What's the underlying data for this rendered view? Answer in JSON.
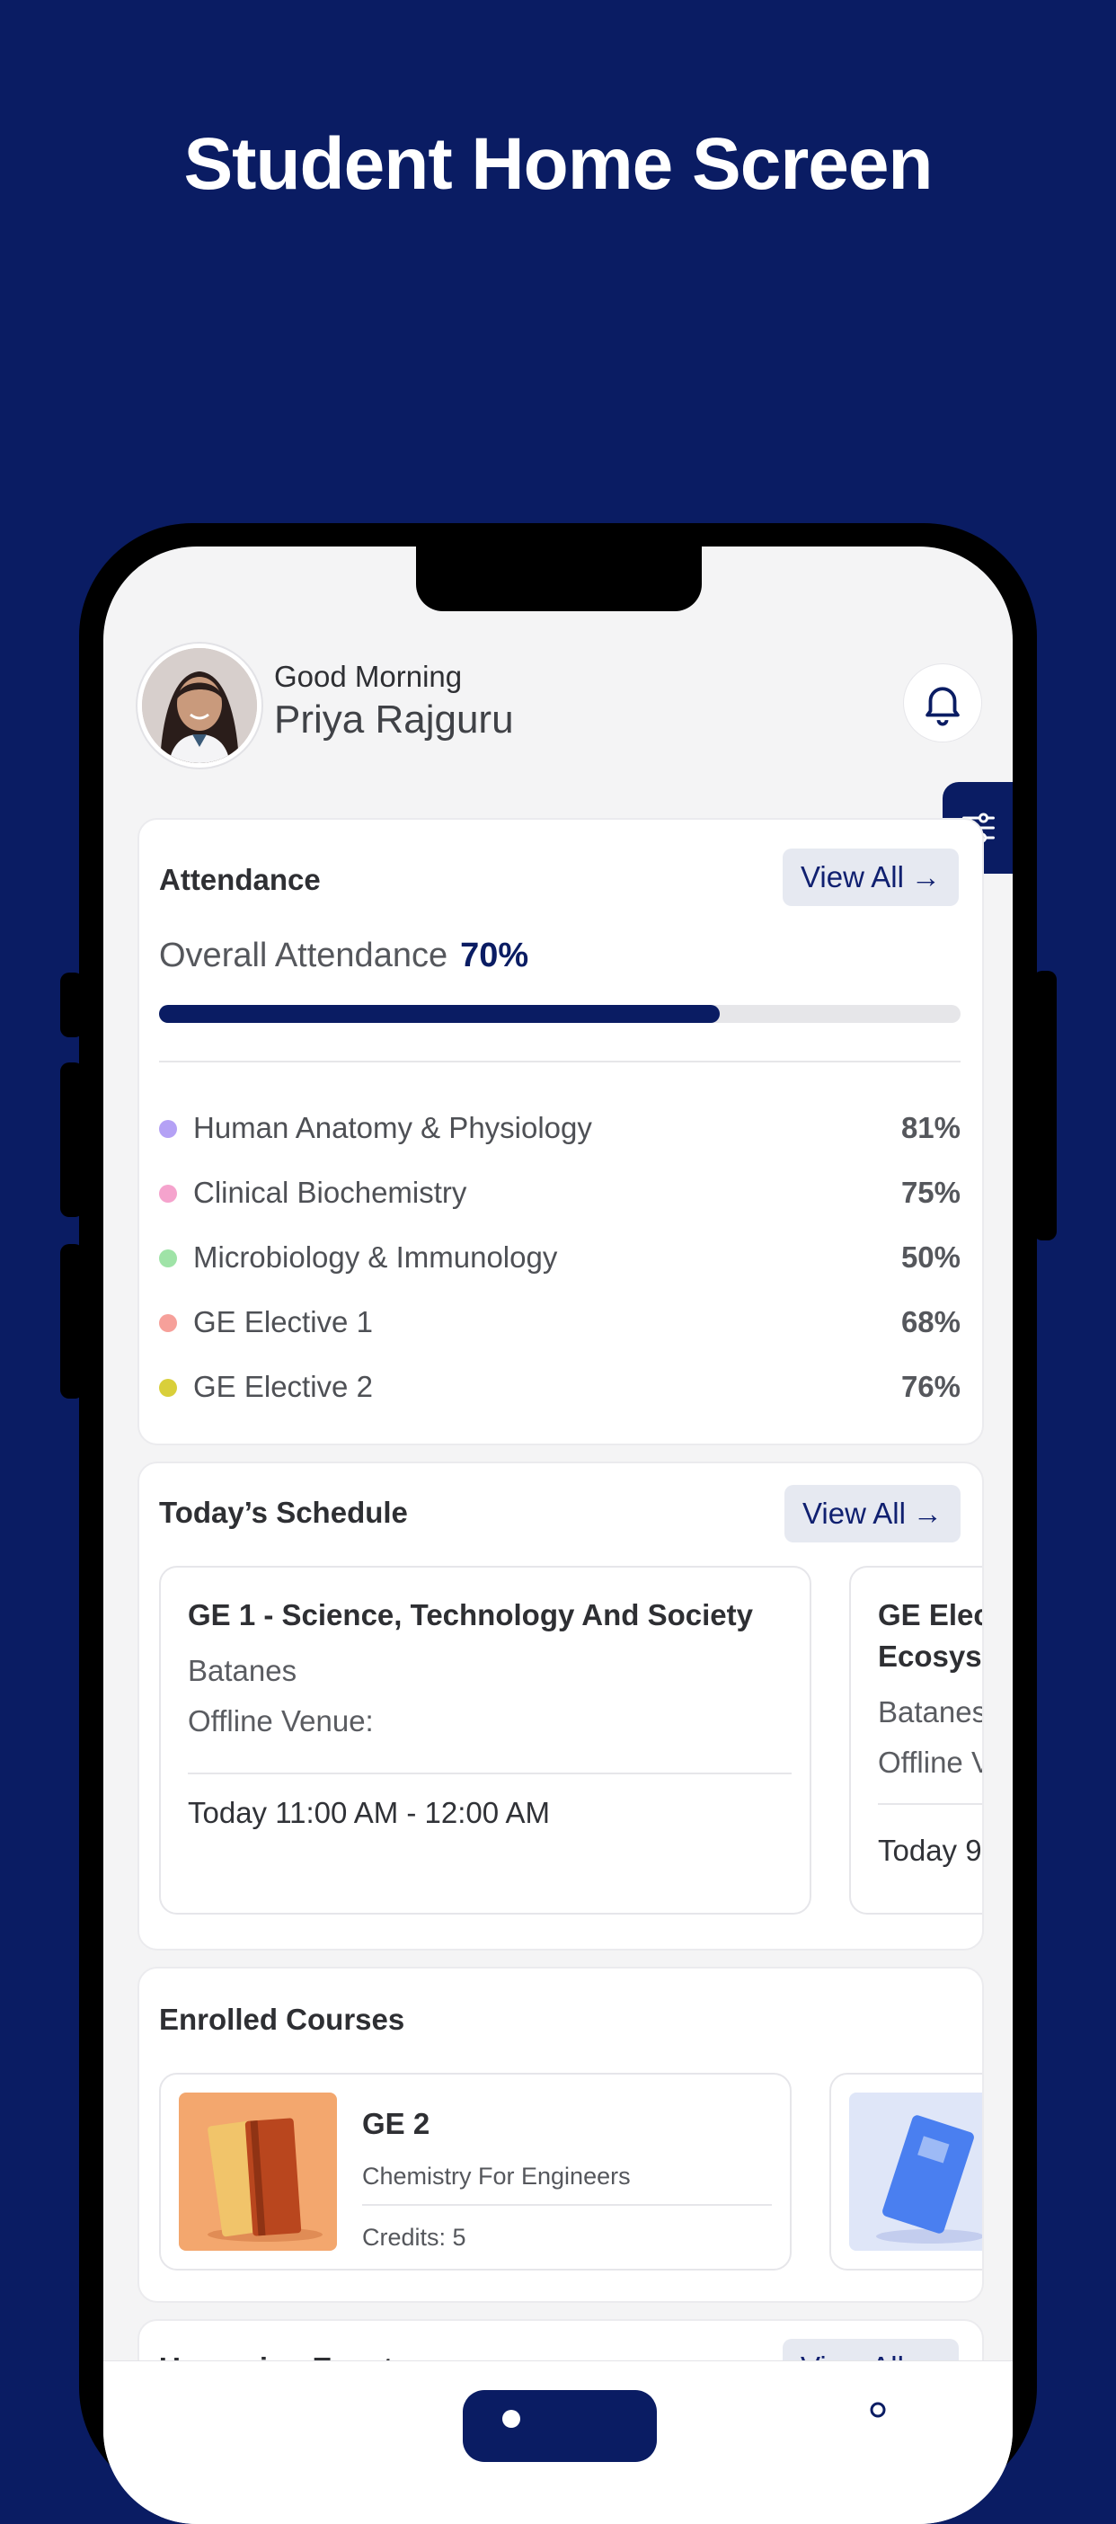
{
  "hero": {
    "title": "Student Home Screen"
  },
  "header": {
    "greeting": "Good Morning",
    "user_name": "Priya Rajguru"
  },
  "attendance": {
    "title": "Attendance",
    "view_all": "View All",
    "overall_label": "Overall Attendance",
    "overall_value": "70%",
    "overall_fraction": 0.7,
    "subjects": [
      {
        "name": "Human Anatomy & Physiology",
        "pct": "81%",
        "color": "#b4a1f5"
      },
      {
        "name": "Clinical Biochemistry",
        "pct": "75%",
        "color": "#f5a3cd"
      },
      {
        "name": "Microbiology & Immunology",
        "pct": "50%",
        "color": "#9fe3a7"
      },
      {
        "name": "GE Elective 1",
        "pct": "68%",
        "color": "#f6a09a"
      },
      {
        "name": "GE Elective 2",
        "pct": "76%",
        "color": "#d9cf3a"
      }
    ]
  },
  "schedule": {
    "title": "Today’s Schedule",
    "view_all": "View All",
    "items": [
      {
        "title": "GE 1 - Science, Technology And Society",
        "location": "Batanes",
        "venue": "Offline Venue:",
        "day": "Today",
        "time": "11:00 AM - 12:00 AM"
      },
      {
        "title_line1": "GE Elec",
        "title_line2": "Ecosyst",
        "location": "Batanes",
        "venue": "Offline V",
        "day": "Today",
        "time": "9"
      }
    ]
  },
  "courses": {
    "title": "Enrolled Courses",
    "items": [
      {
        "code": "GE 2",
        "name": "Chemistry For Engineers",
        "credits": "Credits: 5"
      }
    ]
  },
  "upcoming": {
    "title": "Upcoming Events",
    "view_all": "View All"
  },
  "colors": {
    "brand": "#0a1c63",
    "accent_bg": "#e6e9f1"
  }
}
